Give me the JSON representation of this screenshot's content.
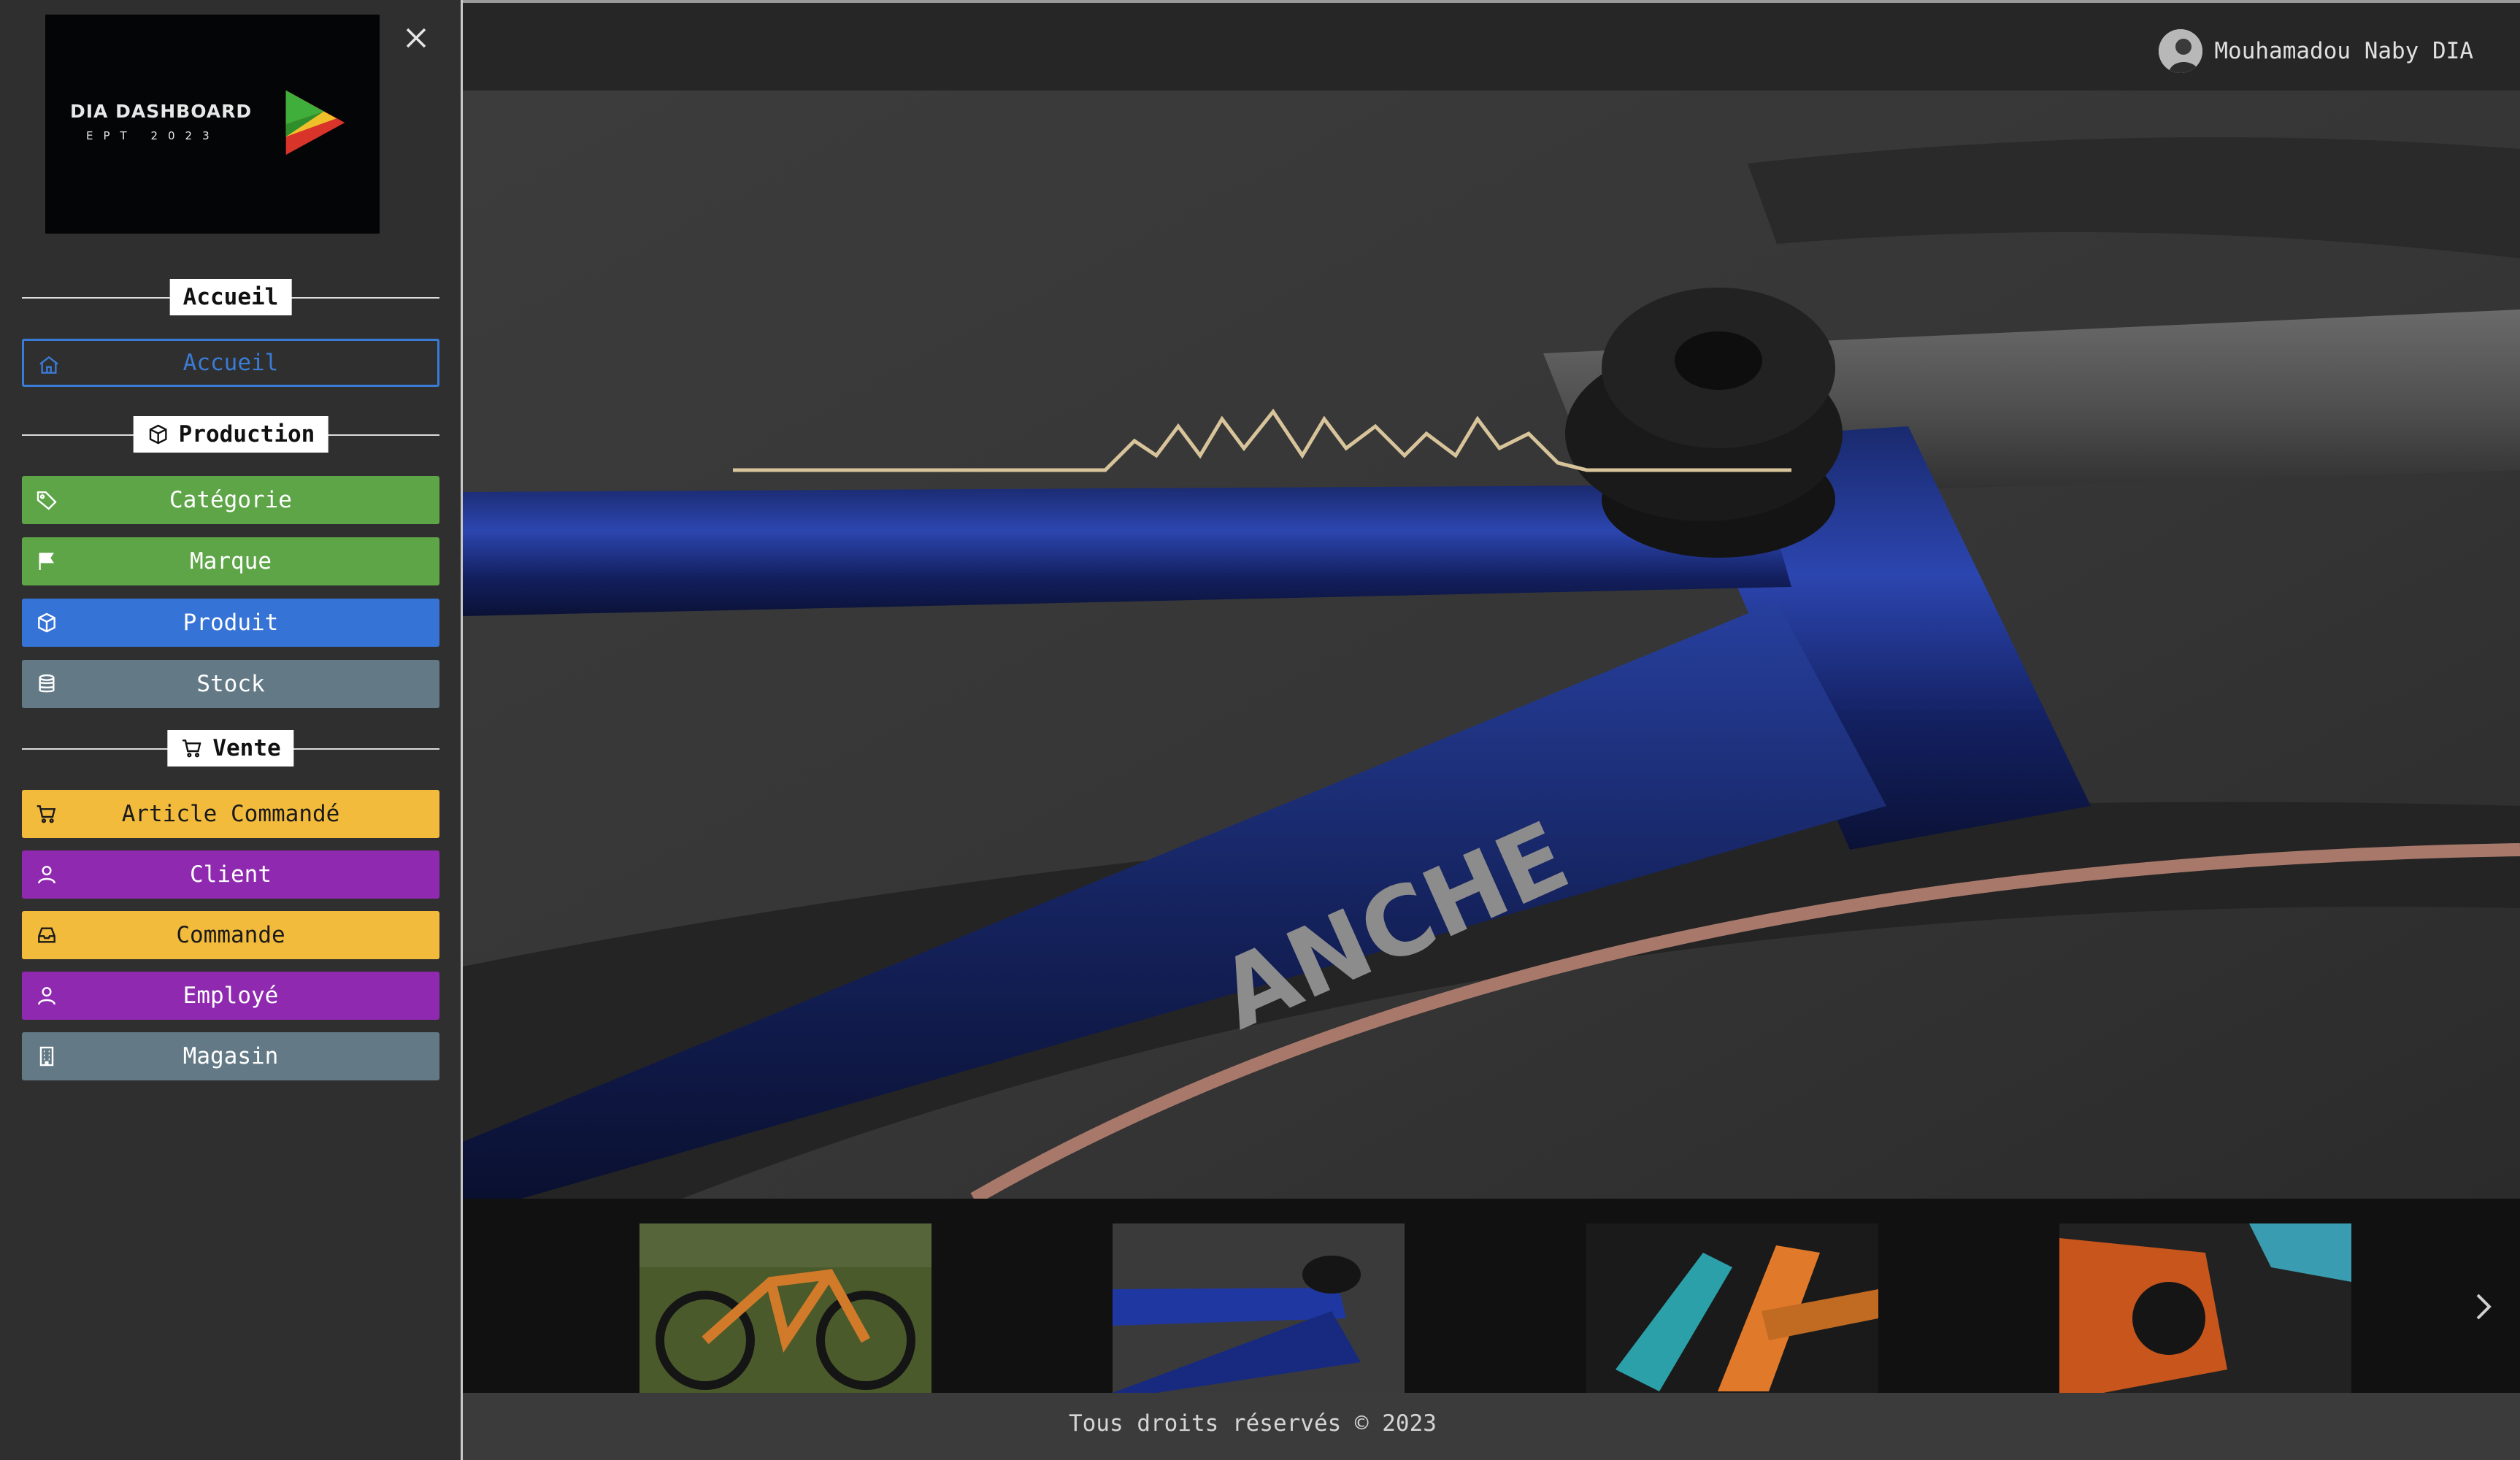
{
  "sidebar": {
    "logo": {
      "title": "DIA DASHBOARD",
      "subtitle": "EPT 2023"
    },
    "sections": {
      "accueil": {
        "title": "Accueil"
      },
      "production": {
        "title": "Production"
      },
      "vente": {
        "title": "Vente"
      }
    },
    "items": {
      "accueil": "Accueil",
      "categorie": "Catégorie",
      "marque": "Marque",
      "produit": "Produit",
      "stock": "Stock",
      "article_commande": "Article Commandé",
      "client": "Client",
      "commande": "Commande",
      "employe": "Employé",
      "magasin": "Magasin"
    }
  },
  "header": {
    "user_name": "Mouhamadou Naby DIA"
  },
  "carousel": {
    "thumbnail_count": 4
  },
  "footer": {
    "text": "Tous droits réservés © 2023"
  },
  "colors": {
    "green": "#5ea548",
    "blue": "#3673d6",
    "gray": "#637a86",
    "yellow": "#f2bb3c",
    "purple": "#8f2ab0",
    "outline": "#3a7bd5"
  },
  "icons": [
    "close-icon",
    "home-icon",
    "box-icon",
    "tag-icon",
    "flag-icon",
    "database-icon",
    "cart-icon",
    "user-icon",
    "inbox-icon",
    "building-icon",
    "chevron-right-icon"
  ]
}
